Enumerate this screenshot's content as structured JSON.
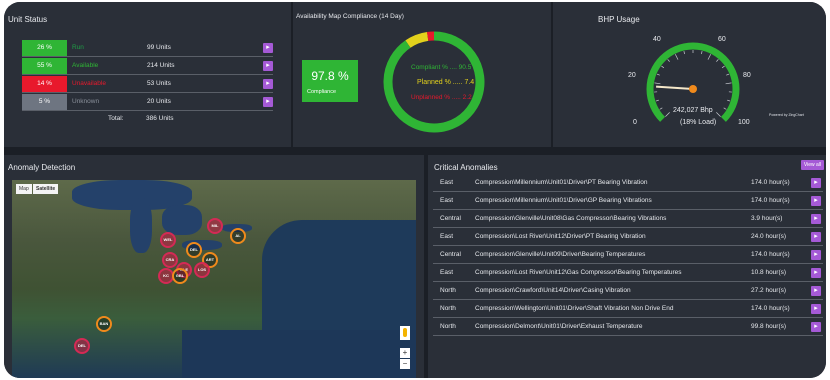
{
  "colors": {
    "green": "#2fb535",
    "red": "#e8192c",
    "gray": "#6e7581",
    "purple": "#a55ad6",
    "yellow": "#e2d11c"
  },
  "unit_status": {
    "title": "Unit Status",
    "rows": [
      {
        "pct": "26 %",
        "label": "Run",
        "count": "99 Units",
        "color": "#2fb535",
        "label_color": "#1f9e45"
      },
      {
        "pct": "55 %",
        "label": "Available",
        "count": "214 Units",
        "color": "#2fb535",
        "label_color": "#2fb535"
      },
      {
        "pct": "14 %",
        "label": "Unavailable",
        "count": "53 Units",
        "color": "#e8192c",
        "label_color": "#e8192c"
      },
      {
        "pct": "5 %",
        "label": "Unknown",
        "count": "20 Units",
        "color": "#6e7581",
        "label_color": "#8a909a"
      }
    ],
    "total_label": "Total:",
    "total_value": "386 Units"
  },
  "availability": {
    "title": "Availability Map Compliance (14 Day)",
    "compliance_value": "97.8 %",
    "compliance_label": "Compliance",
    "compliant_text": "Compliant % .... 90.5",
    "planned_text": "Planned % ..... 7.4",
    "unplanned_text": "Unplanned % ..... 2.2",
    "donut": {
      "compliant": 90.5,
      "planned": 7.4,
      "unplanned": 2.2
    }
  },
  "bhp": {
    "title": "BHP Usage",
    "ticks": [
      "0",
      "20",
      "40",
      "60",
      "80",
      "100"
    ],
    "value_text": "242,027 Bhp",
    "load_text": "(18% Load)",
    "load_percent": 18,
    "powered_by": "Powered by ZingChart"
  },
  "anomaly": {
    "title": "Anomaly Detection",
    "map_tab": "Map",
    "satellite_tab": "Satellite",
    "markers": [
      {
        "label": "MIL",
        "type": "red"
      },
      {
        "label": "WEL",
        "type": "red"
      },
      {
        "label": "AL",
        "type": "orange"
      },
      {
        "label": "DEL",
        "type": "orange"
      },
      {
        "label": "CRA",
        "type": "red"
      },
      {
        "label": "ART",
        "type": "orange"
      },
      {
        "label": "BLE",
        "type": "red"
      },
      {
        "label": "LOS",
        "type": "red"
      },
      {
        "label": "KC",
        "type": "red"
      },
      {
        "label": "GBL",
        "type": "orange"
      },
      {
        "label": "BAN",
        "type": "orange"
      },
      {
        "label": "DEL",
        "type": "red"
      }
    ],
    "zoom_in": "+",
    "zoom_out": "−"
  },
  "critical": {
    "title": "Critical Anomalies",
    "view_all": "View all",
    "rows": [
      {
        "region": "East",
        "path": "Compression\\Millennium\\Unit01\\Driver\\PT Bearing Vibration",
        "hours": "174.0 hour(s)"
      },
      {
        "region": "East",
        "path": "Compression\\Millennium\\Unit01\\Driver\\GP Bearing Vibrations",
        "hours": "174.0 hour(s)"
      },
      {
        "region": "Central",
        "path": "Compression\\Glenville\\Unit08\\Gas Compressor\\Bearing Vibrations",
        "hours": "3.9 hour(s)"
      },
      {
        "region": "East",
        "path": "Compression\\Lost River\\Unit12\\Driver\\PT Bearing Vibration",
        "hours": "24.0 hour(s)"
      },
      {
        "region": "Central",
        "path": "Compression\\Glenville\\Unit09\\Driver\\Bearing Temperatures",
        "hours": "174.0 hour(s)"
      },
      {
        "region": "East",
        "path": "Compression\\Lost River\\Unit12\\Gas Compressor\\Bearing Temperatures",
        "hours": "10.8 hour(s)"
      },
      {
        "region": "North",
        "path": "Compression\\Crawford\\Unit14\\Driver\\Casing Vibration",
        "hours": "27.2 hour(s)"
      },
      {
        "region": "North",
        "path": "Compression\\Wellington\\Unit01\\Driver\\Shaft Vibration Non Drive End",
        "hours": "174.0 hour(s)"
      },
      {
        "region": "North",
        "path": "Compression\\Delmont\\Unit01\\Driver\\Exhaust Temperature",
        "hours": "99.8 hour(s)"
      }
    ]
  }
}
